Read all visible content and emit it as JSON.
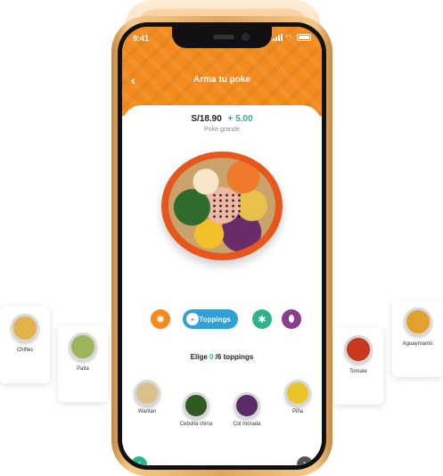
{
  "status": {
    "time": "9:41"
  },
  "header": {
    "title": "Arma tu poke"
  },
  "price": {
    "base": "S/18.90",
    "extra": "+ 5.00",
    "size": "Poke grande"
  },
  "categories": {
    "active_label": "Toppings"
  },
  "prompt": {
    "prefix": "Elige ",
    "count": "0",
    "suffix": " /6 toppings"
  },
  "toppings": [
    {
      "label": "Wantan",
      "color": "#d9c08c"
    },
    {
      "label": "Cebolla china",
      "color": "#2e5a22"
    },
    {
      "label": "Col morada",
      "color": "#5b2a67"
    },
    {
      "label": "Piña",
      "color": "#e9c42a"
    }
  ],
  "floating": [
    {
      "label": "Chifles",
      "color": "#e2b34a"
    },
    {
      "label": "Palta",
      "color": "#9cb55a"
    },
    {
      "label": "Tomate",
      "color": "#c8381f"
    },
    {
      "label": "Aguaymanto",
      "color": "#e2a02c"
    }
  ],
  "colors": {
    "brand_orange": "#f28a1e",
    "accent_green": "#2fb38d",
    "accent_blue": "#2fa0d8",
    "accent_purple": "#8a3c8e"
  },
  "icons": {
    "back": "chevron-left-icon",
    "proteins": "octopus-icon",
    "toppings": "bowl-icon",
    "sauces": "snowflake-icon",
    "extras": "drop-icon",
    "prev": "chevron-left-icon",
    "next": "chevron-right-icon"
  }
}
